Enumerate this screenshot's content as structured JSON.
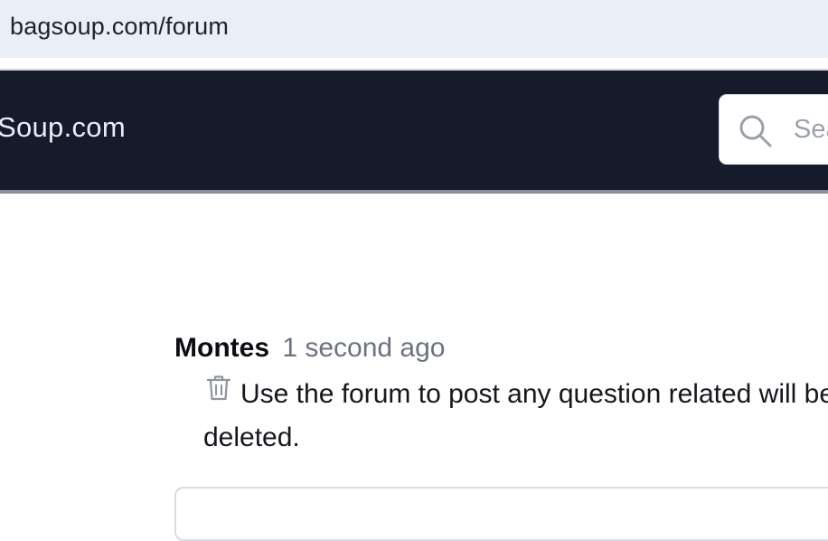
{
  "browser": {
    "url": "bagsoup.com/forum"
  },
  "header": {
    "brand": "Soup.com",
    "search": {
      "placeholder": "Sea",
      "icon": "search-icon"
    },
    "colors": {
      "background": "#151b2b",
      "brand_text": "#e9edf5"
    }
  },
  "comment": {
    "author": "Montes",
    "timestamp": "1 second ago",
    "delete_icon": "trash-icon",
    "message": "Use the forum to post any question related will be deleted."
  }
}
